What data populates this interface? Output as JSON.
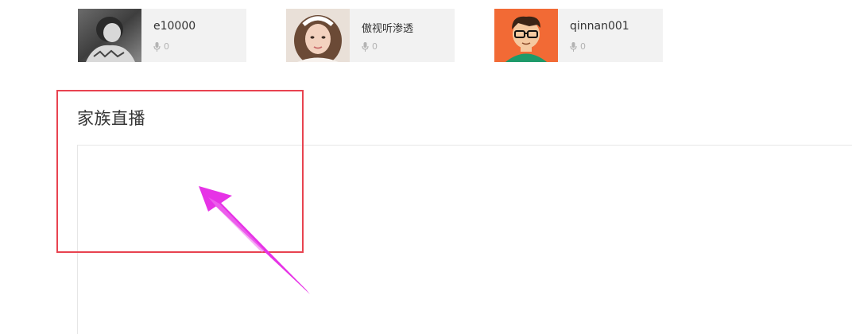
{
  "members": [
    {
      "name": "e10000",
      "count": "0",
      "avatar": "bw-photo-avatar"
    },
    {
      "name": "傲视听渗透",
      "count": "0",
      "avatar": "girl-photo-avatar"
    },
    {
      "name": "qinnan001",
      "count": "0",
      "avatar": "cartoon-glasses-avatar"
    }
  ],
  "section": {
    "title": "家族直播"
  },
  "icons": {
    "microphone": "microphone-icon"
  },
  "colors": {
    "card_bg": "#f2f2f2",
    "highlight": "#e84350",
    "arrow": "#e633e6",
    "cartoon_bg": "#f26a35",
    "muted_text": "#b3b3b3"
  }
}
